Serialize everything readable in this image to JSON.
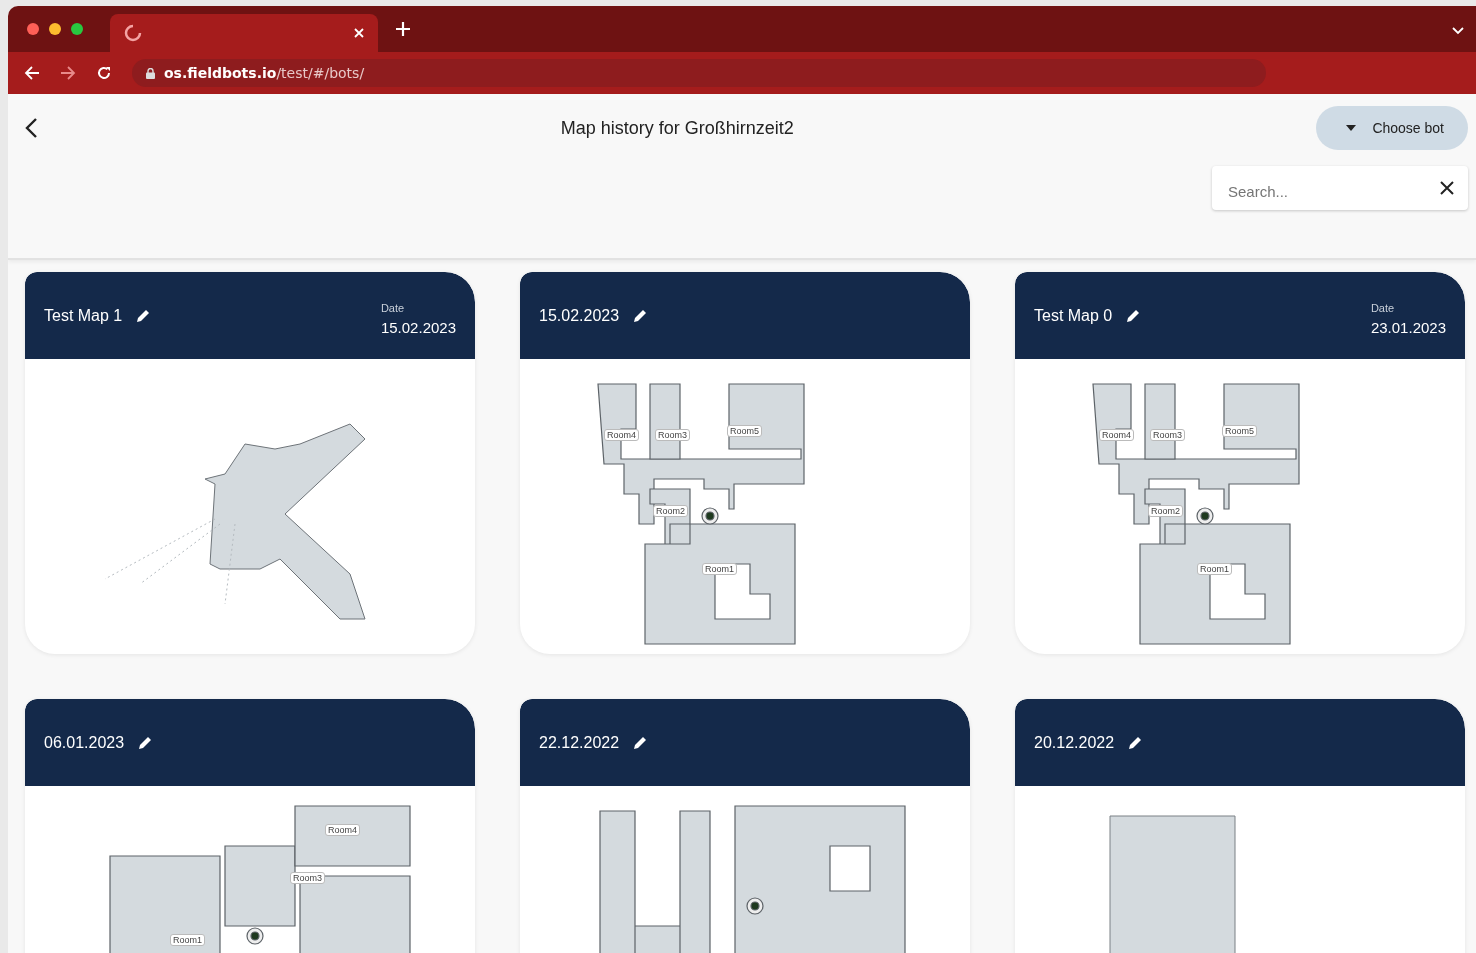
{
  "browser": {
    "url_host": "os.fieldbots.io",
    "url_path": "/test/#/bots/"
  },
  "header": {
    "title": "Map history for Großhirnzeit2",
    "choose_bot": "Choose bot",
    "search": {
      "placeholder": "Search..."
    }
  },
  "maps": [
    {
      "name": "Test Map 1",
      "date": {
        "label": "Date",
        "value": "15.02.2023"
      },
      "kind": "scan"
    },
    {
      "name": "15.02.2023",
      "kind": "floorplan",
      "room_labels": [
        "Room4",
        "Room3",
        "Room5",
        "Room2",
        "Room1"
      ]
    },
    {
      "name": "Test Map 0",
      "date": {
        "label": "Date",
        "value": "23.01.2023"
      },
      "kind": "floorplan",
      "room_labels": [
        "Room4",
        "Room3",
        "Room5",
        "Room2",
        "Room1"
      ]
    },
    {
      "name": "06.01.2023",
      "kind": "wide",
      "room_labels": [
        "Room4",
        "Room3",
        "Room1"
      ]
    },
    {
      "name": "22.12.2022",
      "kind": "rooms"
    },
    {
      "name": "20.12.2022",
      "kind": "block"
    }
  ]
}
